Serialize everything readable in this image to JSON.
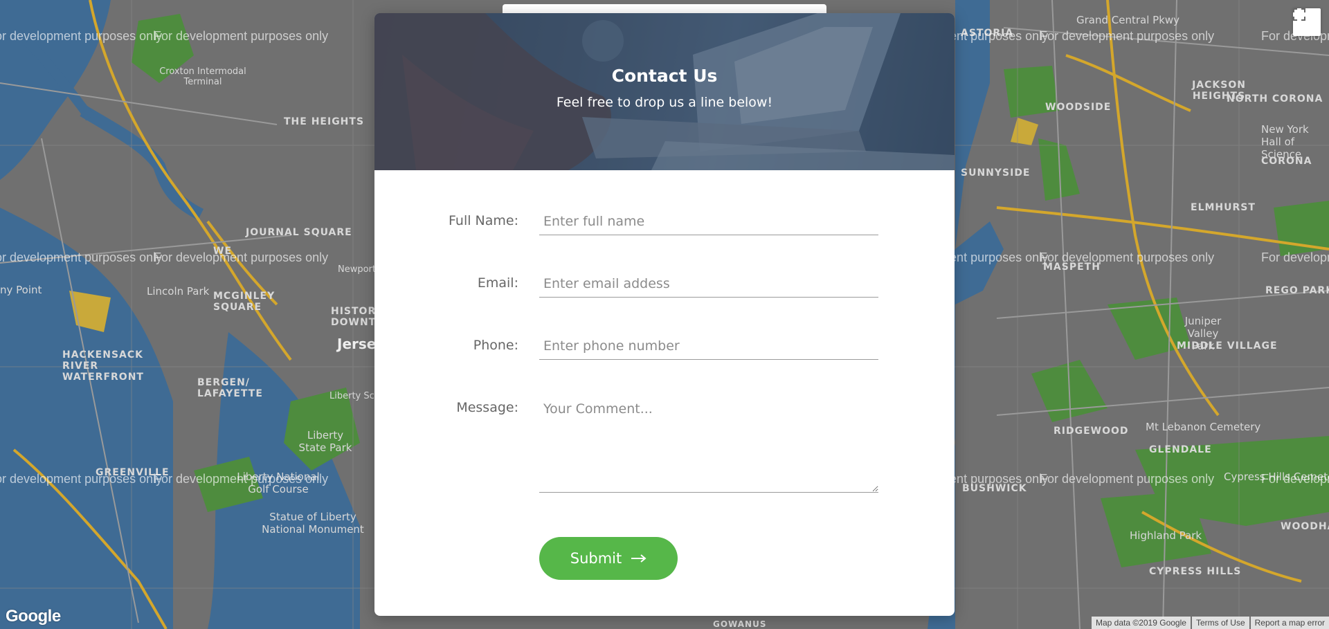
{
  "map": {
    "watermark": "For development purposes only",
    "labels": {
      "astoria": "Astoria",
      "grand_central": "Grand Central Pkwy",
      "croxton": "Croxton Intermodal Terminal",
      "the_heights": "The Heights",
      "jackson_heights": "Jackson Heights",
      "north_corona": "North Corona",
      "woodside": "Woodside",
      "new_york_hall": "New York Hall of Science",
      "corona": "Corona",
      "sunnyside": "Sunnyside",
      "elmhurst": "Elmhurst",
      "journal_square": "Journal Square",
      "mcginley": "McGinley Square",
      "lincoln_park": "Lincoln Park",
      "historic": "Historic Downtown",
      "jersey": "Jerse",
      "maspeth": "Maspeth",
      "rego_park": "Rego Park",
      "juniper": "Juniper Valley Park",
      "middle_village": "Middle Village",
      "hackensack": "Hackensack River Waterfront",
      "bergen": "Bergen/ Lafayette",
      "liberty_state": "Liberty State Park",
      "liberty_sc": "Liberty Sc",
      "ridgewood": "Ridgewood",
      "mt_lebanon": "Mt Lebanon Cemetery",
      "glendale": "Glendale",
      "cypress": "Cypress Hills Cemeter",
      "greenville": "Greenville",
      "bushwick": "Bushwick",
      "liberty_national": "Liberty National Golf Course",
      "statue": "Statue of Liberty National Monument",
      "highland": "Highland Park",
      "cypress_hills": "Cypress Hills",
      "woodha": "Woodha",
      "gowanus": "Gowanus",
      "newport": "Newport Ce",
      "west": "WE",
      "point": "ny Point"
    },
    "footer": {
      "map_data": "Map data ©2019 Google",
      "terms": "Terms of Use",
      "report": "Report a map error"
    },
    "logo": "Google"
  },
  "contact": {
    "title": "Contact Us",
    "subtitle": "Feel free to drop us a line below!",
    "fields": {
      "name_label": "Full Name:",
      "name_placeholder": "Enter full name",
      "email_label": "Email:",
      "email_placeholder": "Enter email addess",
      "phone_label": "Phone:",
      "phone_placeholder": "Enter phone number",
      "message_label": "Message:",
      "message_placeholder": "Your Comment..."
    },
    "submit_label": "Submit",
    "submit_icon": "arrow-right-icon",
    "accent_color": "#56b749"
  }
}
